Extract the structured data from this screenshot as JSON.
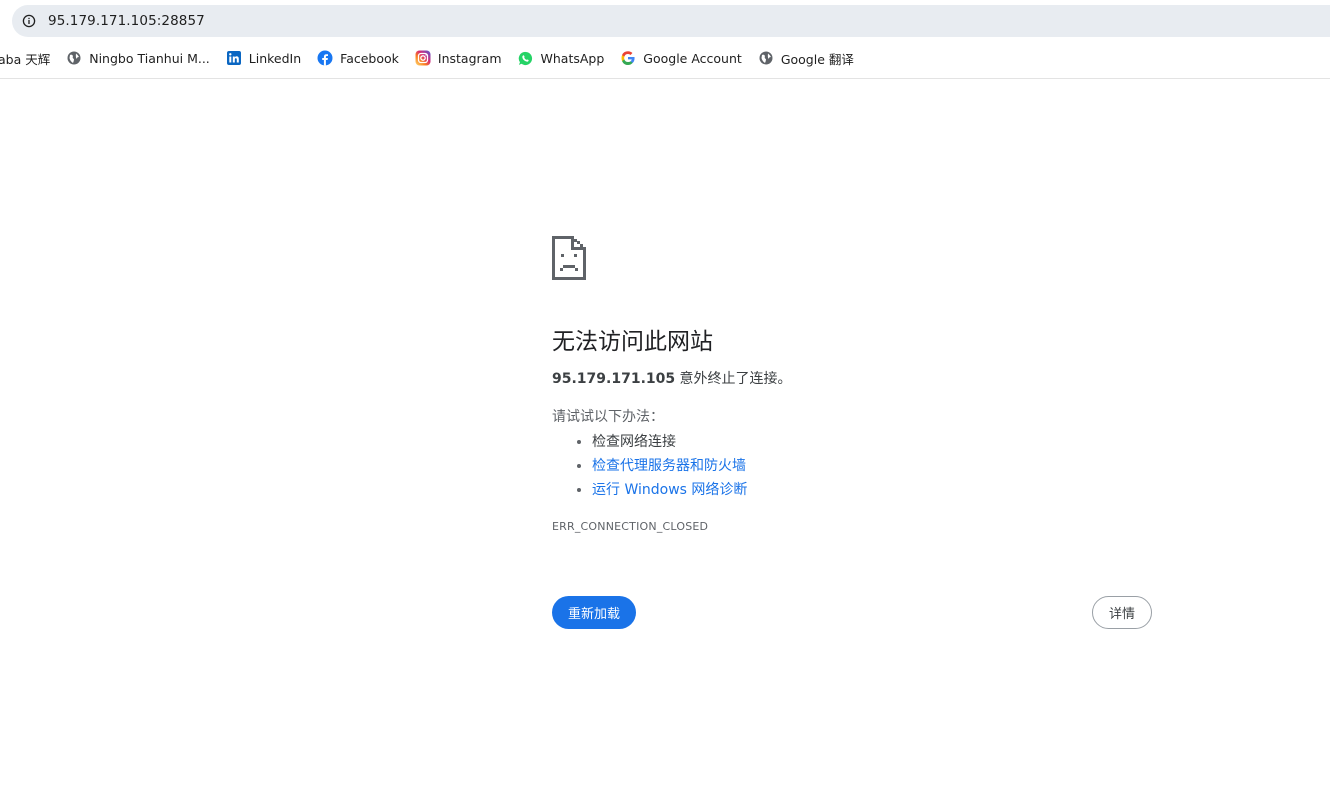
{
  "browser": {
    "url": "95.179.171.105:28857",
    "info_icon": "info-icon"
  },
  "bookmarks": [
    {
      "label": "aba 天辉",
      "icon": "none"
    },
    {
      "label": "Ningbo Tianhui M...",
      "icon": "globe-icon"
    },
    {
      "label": "LinkedIn",
      "icon": "linkedin-icon",
      "color": "#0a66c2"
    },
    {
      "label": "Facebook",
      "icon": "facebook-icon",
      "color": "#1877f2"
    },
    {
      "label": "Instagram",
      "icon": "instagram-icon",
      "color": "#e1306c"
    },
    {
      "label": "WhatsApp",
      "icon": "whatsapp-icon",
      "color": "#25d366"
    },
    {
      "label": "Google Account",
      "icon": "google-icon"
    },
    {
      "label": "Google 翻译",
      "icon": "globe-icon"
    }
  ],
  "error": {
    "icon": "sad-page-icon",
    "title": "无法访问此网站",
    "host": "95.179.171.105",
    "message": " 意外终止了连接。",
    "suggestions_heading": "请试试以下办法：",
    "suggestions": [
      {
        "text": "检查网络连接",
        "link": false
      },
      {
        "text": "检查代理服务器和防火墙",
        "link": true
      },
      {
        "text": "运行 Windows 网络诊断",
        "link": true
      }
    ],
    "code": "ERR_CONNECTION_CLOSED",
    "reload_label": "重新加载",
    "details_label": "详情"
  },
  "colors": {
    "accent": "#1a73e8",
    "omnibox_bg": "#e8ecf1"
  }
}
